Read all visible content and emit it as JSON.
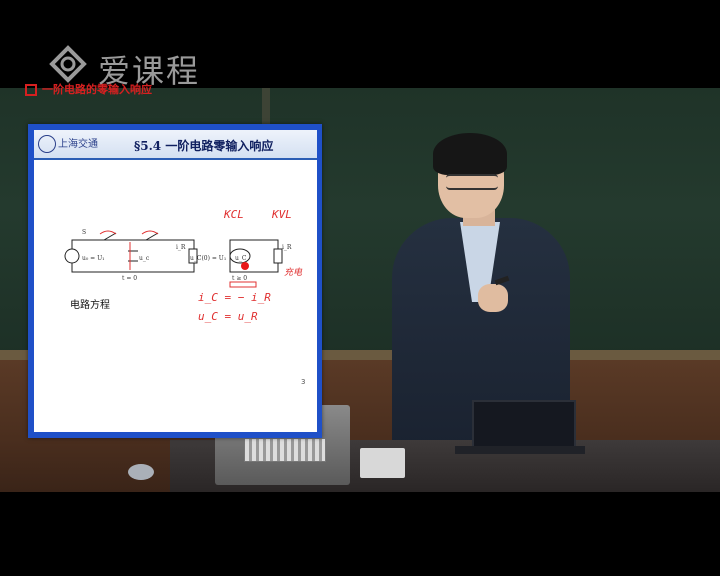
{
  "watermark": {
    "text": "爱课程",
    "icon": "aikecheng-logo-icon"
  },
  "slide": {
    "school_name": "上海交通大学",
    "title": "§5.4  一阶电路零输入响应",
    "bullet": "一阶电路的零输入响应",
    "circuit1": {
      "switch_label": "S",
      "source_label": "u₀ = U₁",
      "cap_label": "u_c",
      "res_label": "i_R",
      "time_label": "t = 0"
    },
    "circuit2": {
      "left_label": "u_C(0) = U₁",
      "cap_label": "u_C",
      "res_label": "i_R",
      "time_label": "t ≥ 0"
    },
    "equation_label": "电路方程",
    "page_number": "3",
    "annotations": {
      "kcl": "KCL",
      "kvl": "KVL",
      "new_label": "充电",
      "eq1": "i_C = − i_R",
      "eq2": "u_C = u_R"
    }
  },
  "colors": {
    "slide_border": "#1f50c8",
    "annotation": "#e03030",
    "title_red": "#d62020"
  }
}
